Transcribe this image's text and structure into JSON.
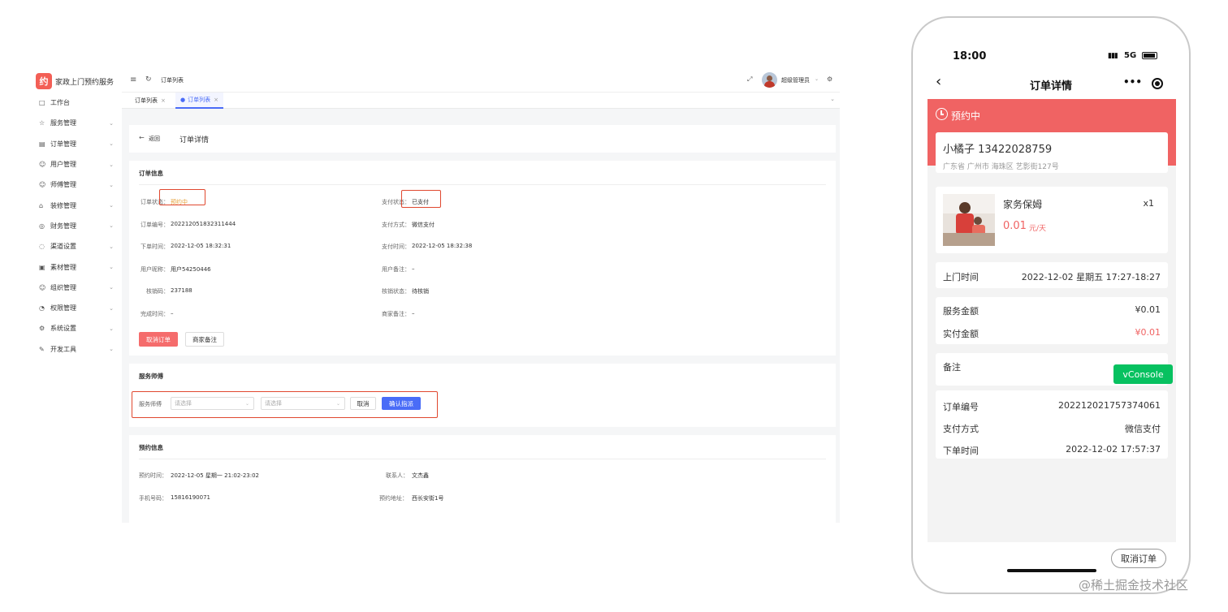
{
  "admin": {
    "brand": {
      "logo_char": "约",
      "name": "家政上门预约服务"
    },
    "sidebar": [
      {
        "icon": "□",
        "label": "工作台",
        "expandable": false
      },
      {
        "icon": "☆",
        "label": "服务管理",
        "expandable": true
      },
      {
        "icon": "▤",
        "label": "订单管理",
        "expandable": true
      },
      {
        "icon": "☺",
        "label": "用户管理",
        "expandable": true
      },
      {
        "icon": "☺",
        "label": "师傅管理",
        "expandable": true
      },
      {
        "icon": "⌂",
        "label": "装修管理",
        "expandable": true
      },
      {
        "icon": "◎",
        "label": "财务管理",
        "expandable": true
      },
      {
        "icon": "◌",
        "label": "渠道设置",
        "expandable": true
      },
      {
        "icon": "▣",
        "label": "素材管理",
        "expandable": true
      },
      {
        "icon": "☺",
        "label": "组织管理",
        "expandable": true
      },
      {
        "icon": "◔",
        "label": "权限管理",
        "expandable": true
      },
      {
        "icon": "⚙",
        "label": "系统设置",
        "expandable": true
      },
      {
        "icon": "✎",
        "label": "开发工具",
        "expandable": true
      }
    ],
    "topbar": {
      "breadcrumb": "订单列表",
      "user_name": "超级管理员"
    },
    "tabs": [
      {
        "label": "订单列表",
        "active": false
      },
      {
        "label": "订单列表",
        "active": true
      }
    ],
    "page_header": {
      "back_label": "返回",
      "title": "订单详情"
    },
    "order_info": {
      "title": "订单信息",
      "left": [
        {
          "label": "订单状态：",
          "value": "预约中"
        },
        {
          "label": "订单编号：",
          "value": "202212051832311444"
        },
        {
          "label": "下单时间：",
          "value": "2022-12-05 18:32:31"
        },
        {
          "label": "用户昵称：",
          "value": "用户54250446"
        },
        {
          "label": "核销码：",
          "value": "237188"
        },
        {
          "label": "完成时间：",
          "value": "–"
        }
      ],
      "right": [
        {
          "label": "支付状态：",
          "value": "已支付"
        },
        {
          "label": "支付方式：",
          "value": "微信支付"
        },
        {
          "label": "支付时间：",
          "value": "2022-12-05 18:32:38"
        },
        {
          "label": "用户备注：",
          "value": "–"
        },
        {
          "label": "核销状态：",
          "value": "待核销"
        },
        {
          "label": "商家备注：",
          "value": "–"
        }
      ],
      "status_color": "#e6a23c",
      "cancel_button": "取消订单",
      "remark_button": "商家备注"
    },
    "service_master": {
      "title": "服务师傅",
      "field_label": "服务师傅",
      "select1_placeholder": "请选择",
      "select2_placeholder": "请选择",
      "cancel_button": "取消",
      "confirm_button": "确认指派"
    },
    "booking_info": {
      "title": "预约信息",
      "booking_time_label": "预约时间：",
      "booking_time": "2022-12-05 星期一 21:02-23:02",
      "contact_label": "联系人：",
      "contact": "文杰鑫",
      "phone_label": "手机号码：",
      "phone": "15816190071",
      "address_label": "预约地址：",
      "address": "西长安街1号"
    }
  },
  "phone": {
    "status_bar": {
      "time": "18:00",
      "network": "5G"
    },
    "nav": {
      "title": "订单详情"
    },
    "banner": {
      "status": "预约中",
      "color": "#f06363"
    },
    "customer": {
      "name_phone": "小橘子 13422028759",
      "address": "广东省 广州市 海珠区 艺影街127号"
    },
    "product": {
      "name": "家务保姆",
      "qty": "x1",
      "price": "0.01",
      "unit": "元/天"
    },
    "visit": {
      "label": "上门时间",
      "value": "2022-12-02 星期五 17:27-18:27"
    },
    "amounts": [
      {
        "label": "服务金额",
        "value": "¥0.01"
      },
      {
        "label": "实付金额",
        "value": "¥0.01"
      }
    ],
    "remark": {
      "label": "备注",
      "vconsole": "vConsole"
    },
    "order": [
      {
        "label": "订单编号",
        "value": "202212021757374061"
      },
      {
        "label": "支付方式",
        "value": "微信支付"
      },
      {
        "label": "下单时间",
        "value": "2022-12-02 17:57:37"
      }
    ],
    "cancel_button": "取消订单"
  },
  "watermark": "@稀土掘金技术社区"
}
